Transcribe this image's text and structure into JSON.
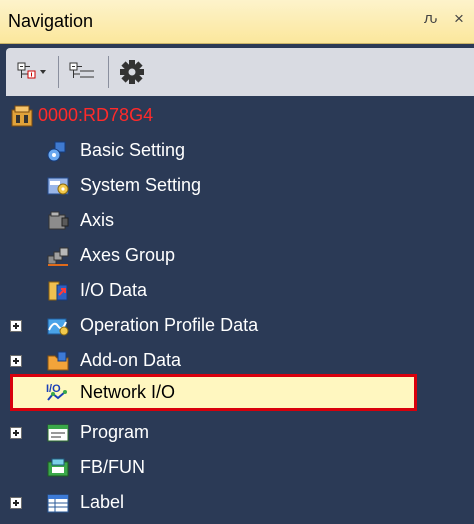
{
  "panel": {
    "title": "Navigation",
    "pin_glyph": "ԉ",
    "close_glyph": "×"
  },
  "toolbar": {
    "buttons": [
      {
        "icon": "tree-collapse-icon",
        "has_dropdown": true
      },
      {
        "icon": "tree-expand-icon"
      },
      {
        "icon": "gear-icon"
      }
    ]
  },
  "tree": {
    "root": {
      "label": "0000:RD78G4",
      "icon": "module-icon",
      "color": "#ff2a2a"
    },
    "items": [
      {
        "label": "Basic Setting",
        "icon": "basic-setting-icon"
      },
      {
        "label": "System Setting",
        "icon": "system-setting-icon"
      },
      {
        "label": "Axis",
        "icon": "axis-icon"
      },
      {
        "label": "Axes Group",
        "icon": "axes-group-icon"
      },
      {
        "label": "I/O Data",
        "icon": "io-data-icon"
      },
      {
        "label": "Operation Profile Data",
        "icon": "operation-profile-icon",
        "expandable": true
      },
      {
        "label": "Add-on Data",
        "icon": "add-on-icon",
        "expandable": true
      },
      {
        "label": "Network I/O",
        "icon": "network-io-icon",
        "selected": true
      },
      {
        "label": "Program",
        "icon": "program-icon",
        "expandable": true
      },
      {
        "label": "FB/FUN",
        "icon": "fb-fun-icon"
      },
      {
        "label": "Label",
        "icon": "label-icon",
        "expandable": true
      }
    ]
  },
  "colors": {
    "panel_bg": "#2b3a56",
    "title_bg": "#fbe79c",
    "highlight_border": "#d8000c",
    "highlight_bg": "#fff7c0"
  }
}
